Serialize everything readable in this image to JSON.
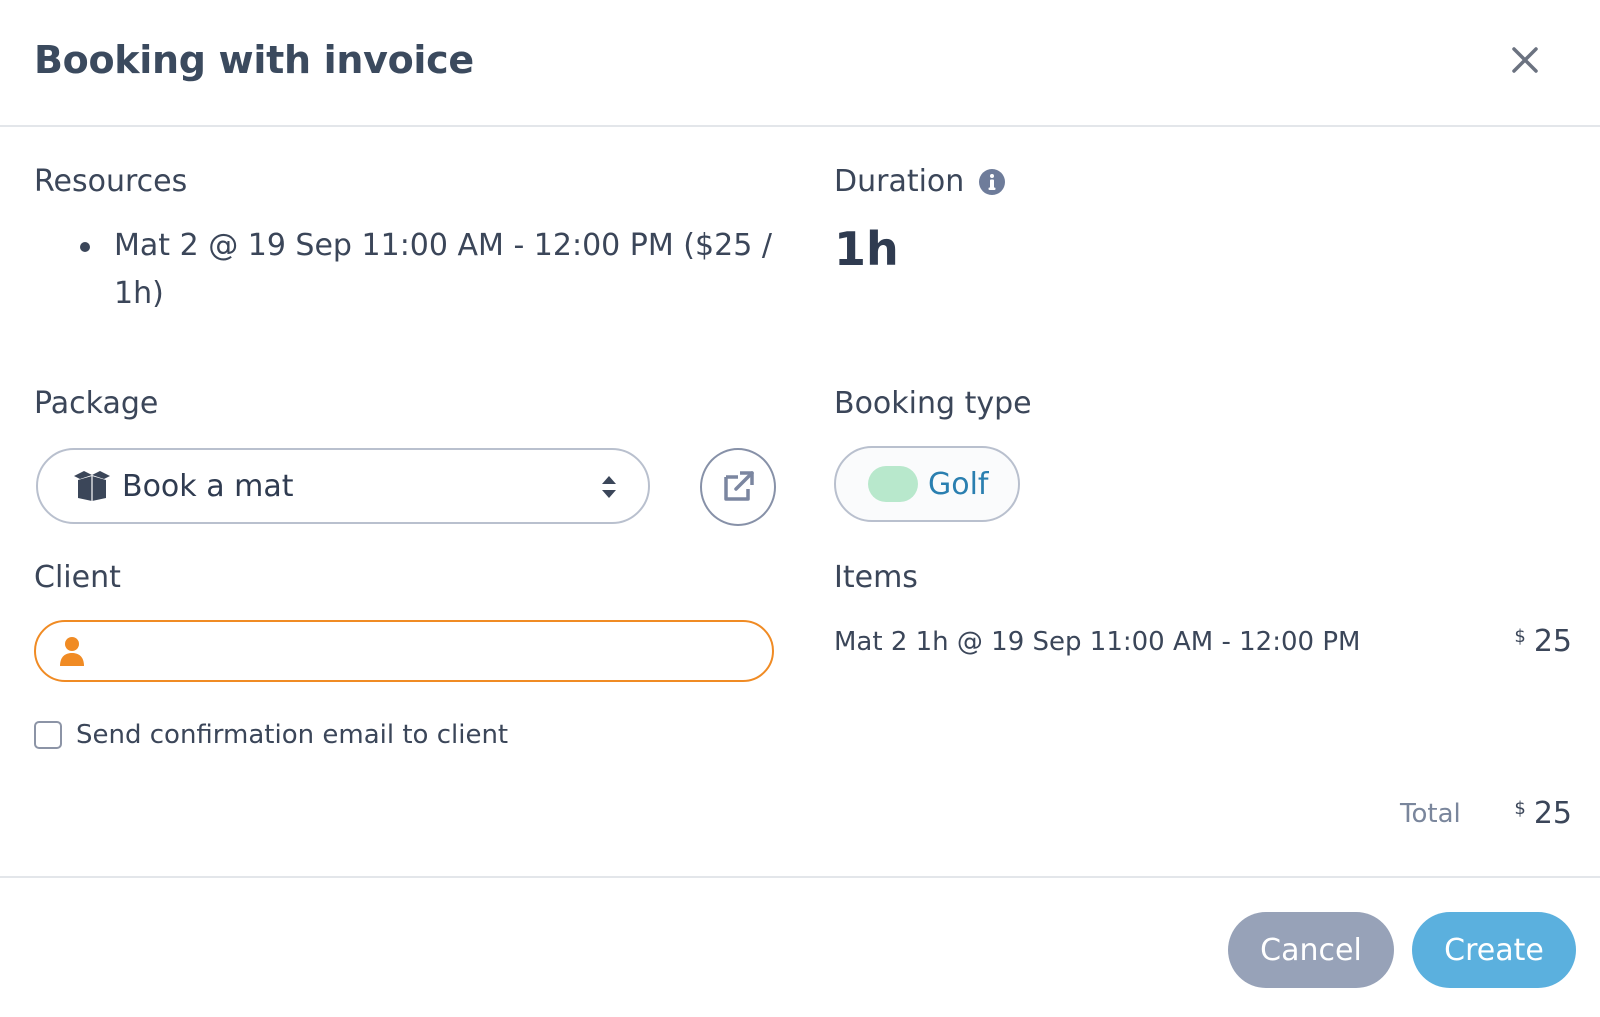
{
  "modal": {
    "title": "Booking with invoice"
  },
  "resources": {
    "label": "Resources",
    "items": [
      "Mat 2 @ 19 Sep 11:00 AM - 12:00 PM ($25 / 1h)"
    ]
  },
  "duration": {
    "label": "Duration",
    "value": "1h",
    "icon": "info-icon"
  },
  "package": {
    "label": "Package",
    "selected": "Book a mat",
    "icon": "box-icon"
  },
  "booking_type": {
    "label": "Booking type",
    "value": "Golf",
    "swatch_color": "#b8e8cc"
  },
  "client": {
    "label": "Client",
    "value": "",
    "placeholder": ""
  },
  "confirmation": {
    "label": "Send confirmation email to client",
    "checked": false
  },
  "items": {
    "label": "Items",
    "rows": [
      {
        "description": "Mat 2 1h @ 19 Sep 11:00 AM - 12:00 PM",
        "currency": "$",
        "amount": "25"
      }
    ]
  },
  "total": {
    "label": "Total",
    "currency": "$",
    "amount": "25"
  },
  "footer": {
    "cancel_label": "Cancel",
    "create_label": "Create"
  },
  "colors": {
    "accent": "#5bb0de",
    "client_border": "#f08b24",
    "cancel_bg": "#97a2b8"
  }
}
